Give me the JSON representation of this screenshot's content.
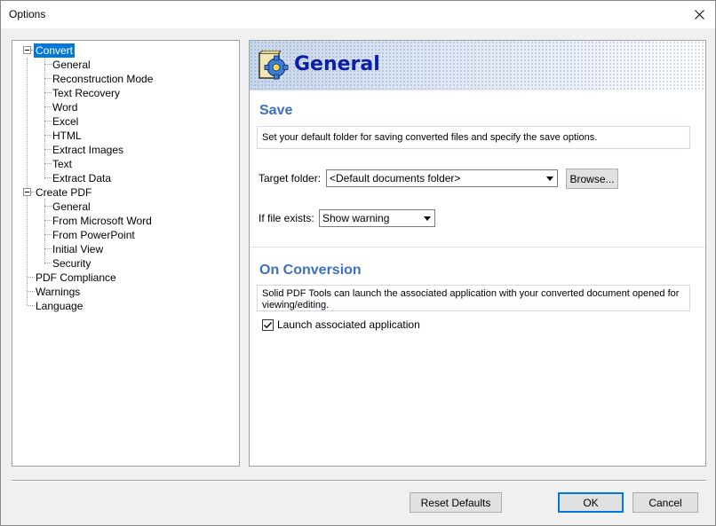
{
  "window": {
    "title": "Options"
  },
  "tree": {
    "items": [
      {
        "label": "Convert"
      },
      {
        "label": "General"
      },
      {
        "label": "Reconstruction Mode"
      },
      {
        "label": "Text Recovery"
      },
      {
        "label": "Word"
      },
      {
        "label": "Excel"
      },
      {
        "label": "HTML"
      },
      {
        "label": "Extract Images"
      },
      {
        "label": "Text"
      },
      {
        "label": "Extract Data"
      },
      {
        "label": "Create PDF"
      },
      {
        "label": "General"
      },
      {
        "label": "From Microsoft Word"
      },
      {
        "label": "From PowerPoint"
      },
      {
        "label": "Initial View"
      },
      {
        "label": "Security"
      },
      {
        "label": "PDF Compliance"
      },
      {
        "label": "Warnings"
      },
      {
        "label": "Language"
      }
    ]
  },
  "panel": {
    "heading": "General",
    "save": {
      "title": "Save",
      "description": "Set your default folder for saving converted files and specify the save options.",
      "target_folder_label": "Target folder:",
      "target_folder_value": "<Default documents folder>",
      "browse_label": "Browse...",
      "if_exists_label": "If file exists:",
      "if_exists_value": "Show warning"
    },
    "conversion": {
      "title": "On Conversion",
      "description": "Solid PDF Tools can launch the associated application with your converted document opened for viewing/editing.",
      "launch_label": "Launch associated application",
      "launch_checked": true
    }
  },
  "footer": {
    "reset_label": "Reset Defaults",
    "ok_label": "OK",
    "cancel_label": "Cancel"
  },
  "colors": {
    "accent": "#0078d7",
    "section_title": "#3c6fc4",
    "banner_title": "#0b1fa8"
  },
  "icons": {
    "close": "close-icon",
    "dropdown": "chevron-down-icon",
    "banner": "settings-gear-icon",
    "checkbox": "checkmark-icon"
  }
}
